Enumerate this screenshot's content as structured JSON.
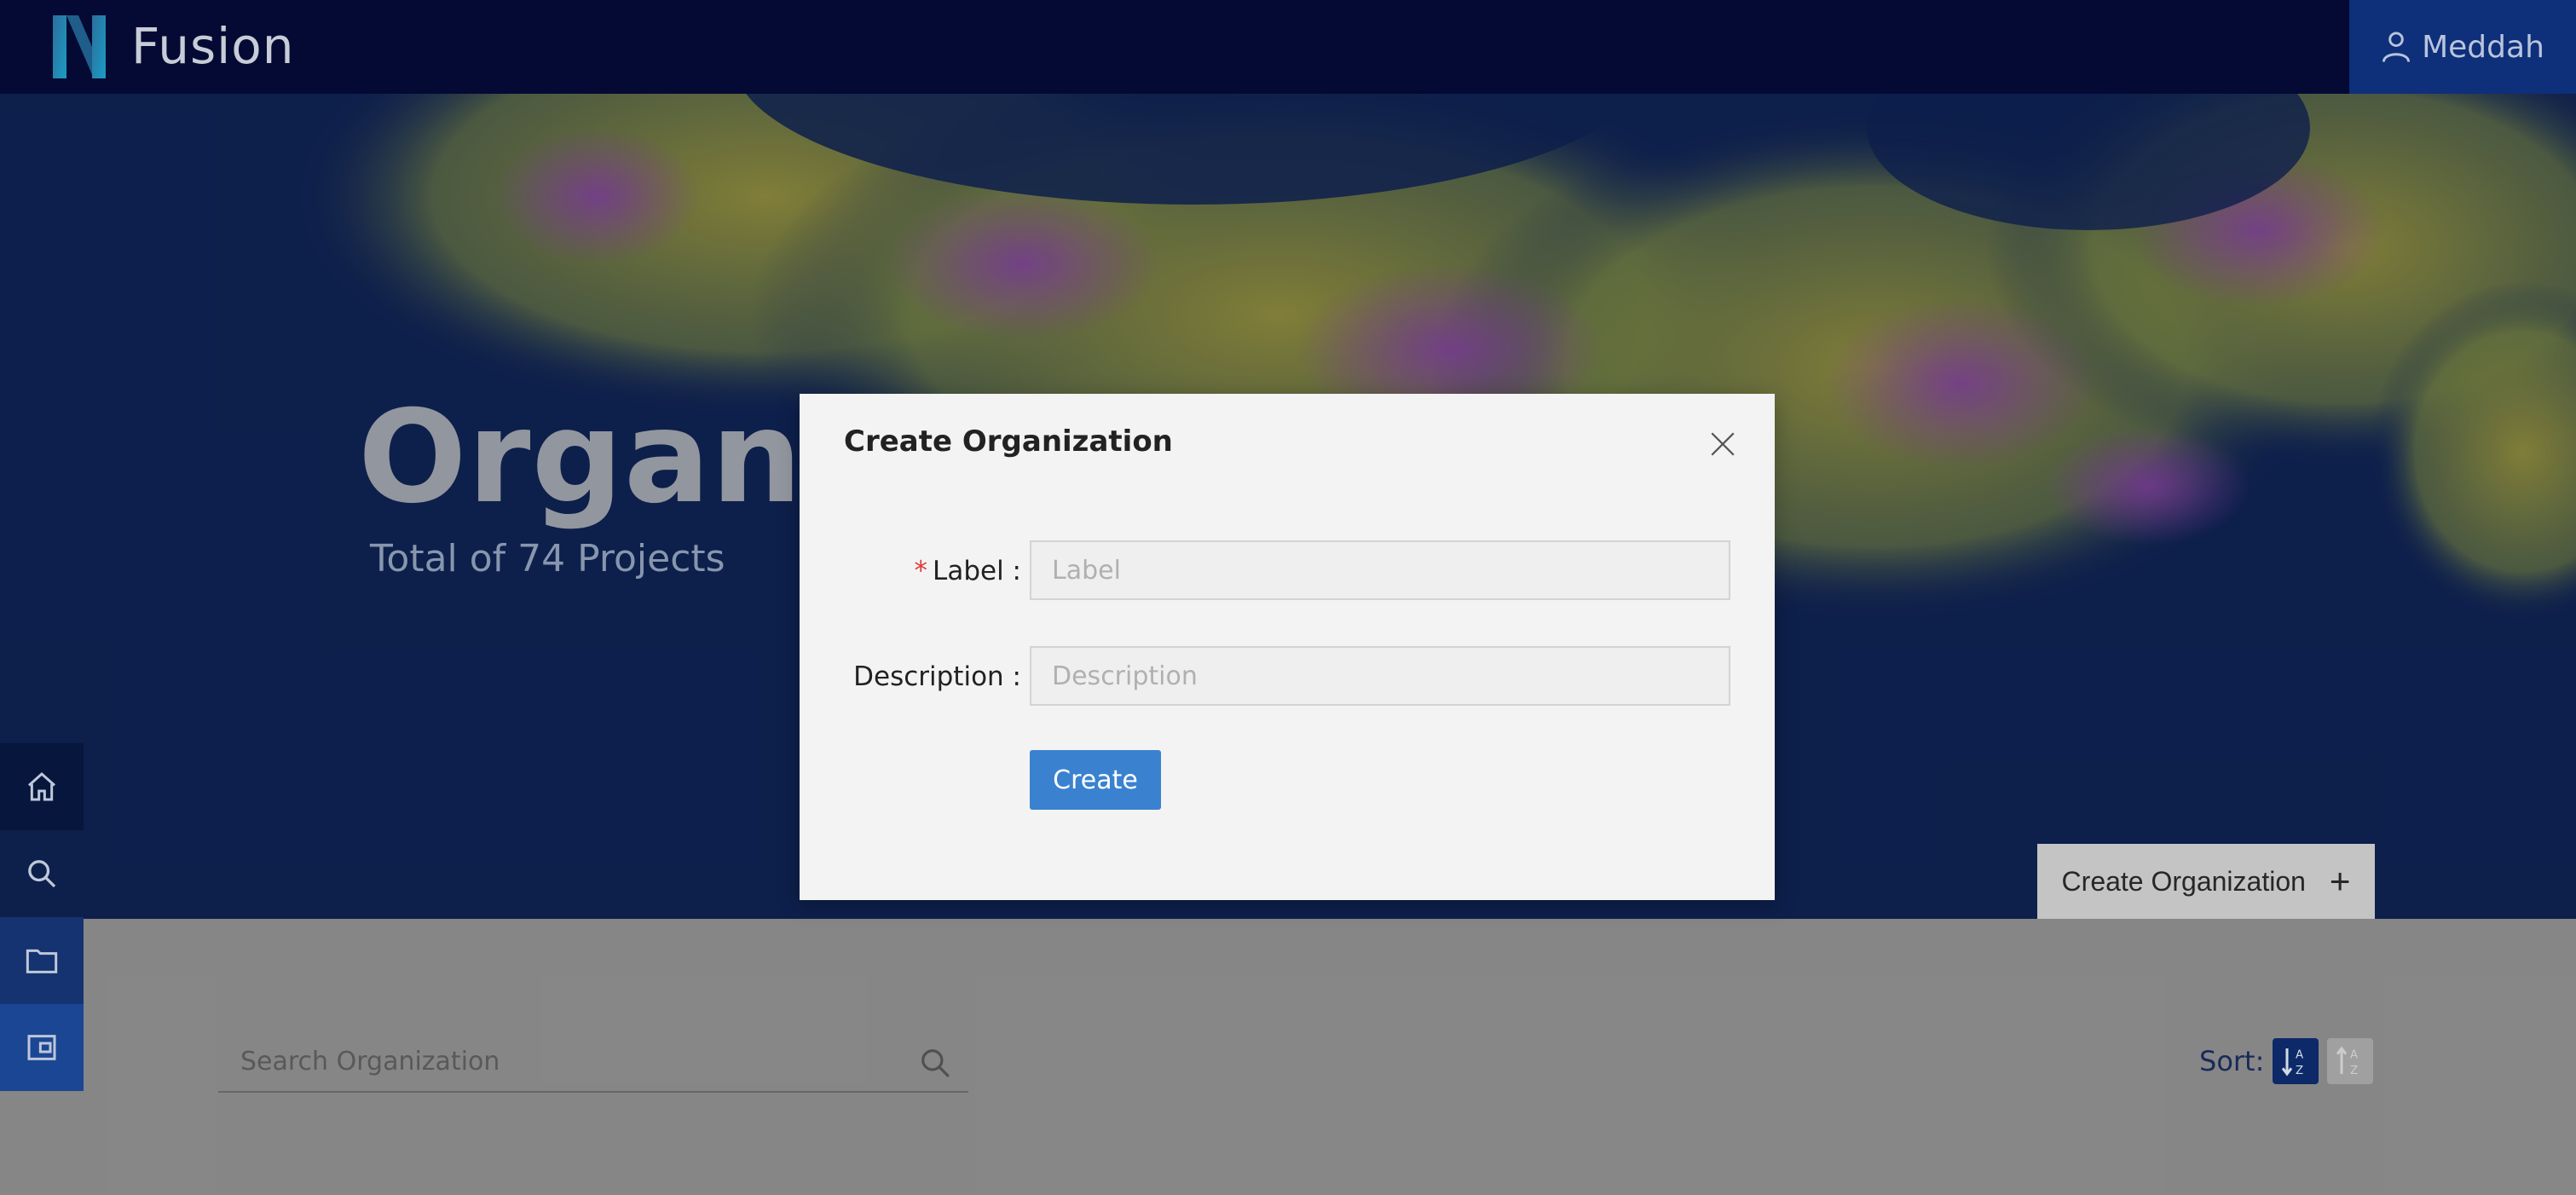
{
  "app": {
    "brand": "Fusion",
    "user_name": "Meddah"
  },
  "hero": {
    "title": "Organiz",
    "subtitle": "Total of 74 Projects",
    "create_button_label": "Create Organization"
  },
  "nav": {
    "items": [
      {
        "icon": "home-icon"
      },
      {
        "icon": "search-icon"
      },
      {
        "icon": "folder-icon"
      },
      {
        "icon": "wallet-icon"
      }
    ]
  },
  "search": {
    "placeholder": "Search Organization",
    "value": ""
  },
  "sort": {
    "label": "Sort:",
    "options": [
      "ascending",
      "descending"
    ],
    "active": "ascending"
  },
  "modal": {
    "title": "Create Organization",
    "fields": [
      {
        "label": "Label",
        "required": true,
        "placeholder": "Label",
        "value": ""
      },
      {
        "label": "Description",
        "required": false,
        "placeholder": "Description",
        "value": ""
      }
    ],
    "submit_label": "Create"
  },
  "colors": {
    "topbar": "#040a33",
    "hero_bg": "#0e2150",
    "accent": "#3a82cf",
    "required": "#e03b3b"
  }
}
